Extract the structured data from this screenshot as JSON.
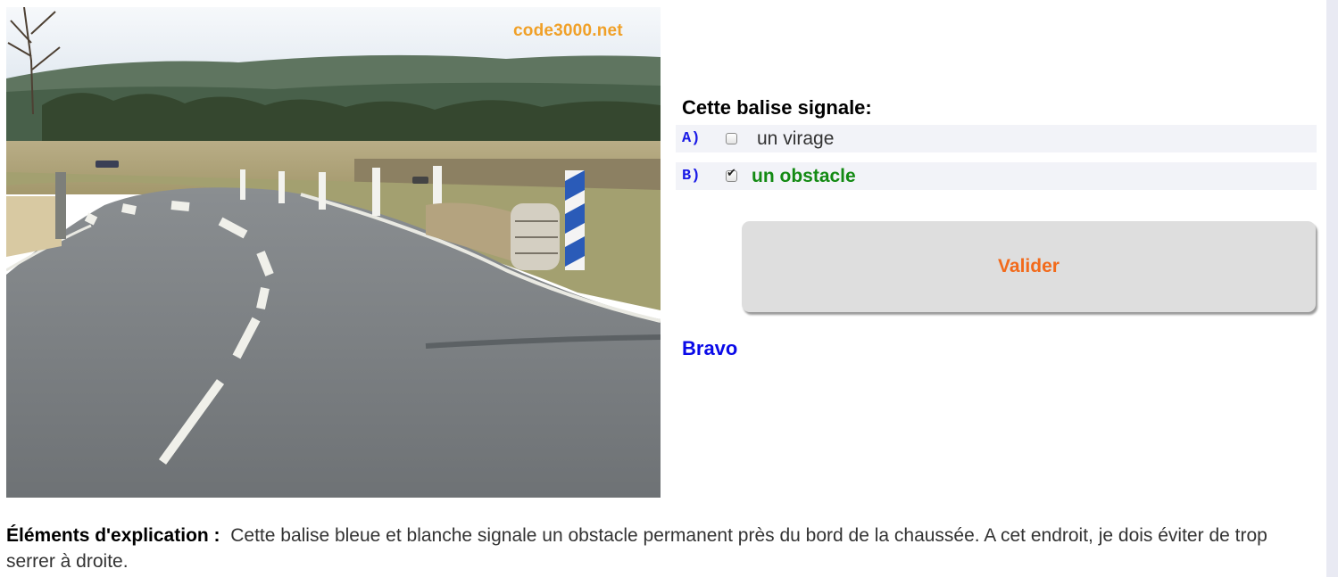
{
  "photo": {
    "watermark": "code3000.net",
    "description_icon": "road-curve-obstacle-photo"
  },
  "question": {
    "text": "Cette balise signale:"
  },
  "answers": [
    {
      "letter": "A)",
      "text": "un virage",
      "checked": false
    },
    {
      "letter": "B)",
      "text": "un obstacle",
      "checked": true
    }
  ],
  "validate": {
    "label": "Valider"
  },
  "result": {
    "text": "Bravo"
  },
  "explanation": {
    "label": "Éléments d'explication :",
    "text": "Cette balise bleue et blanche signale un obstacle permanent près du bord de la chaussée. A cet endroit, je dois éviter de trop serrer à droite."
  },
  "colors": {
    "letters": "#1a1ae6",
    "correct_answer": "#138a13",
    "validate_text": "#f26a1b",
    "result_text": "#0a0ae8",
    "watermark": "#f0a028"
  }
}
